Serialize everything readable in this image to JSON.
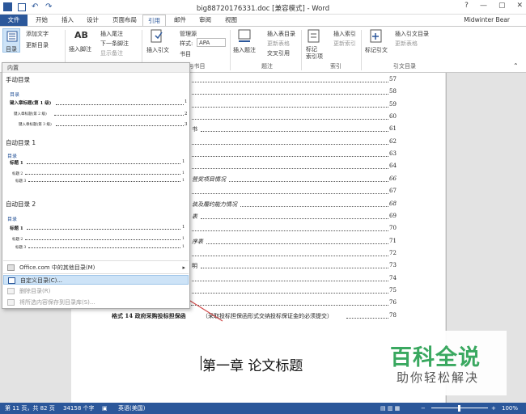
{
  "window": {
    "title": "big88720176331.doc [兼容模式] - Word",
    "user": "Midwinter Bear",
    "controls": [
      "?",
      "—",
      "▢",
      "✕"
    ]
  },
  "tabs": [
    "文件",
    "开始",
    "插入",
    "设计",
    "页面布局",
    "引用",
    "邮件",
    "审阅",
    "视图"
  ],
  "active_tab": "引用",
  "ribbon": {
    "toc": {
      "button": "目录",
      "add_text": "添加文字",
      "update": "更新目录"
    },
    "footnotes": {
      "insert_footnote": "插入脚注",
      "insert_endnote": "插入尾注",
      "next_footnote": "下一条脚注",
      "show_notes": "显示备注",
      "ab": "AB",
      "group": "脚注"
    },
    "citations": {
      "insert_citation": "插入引文",
      "manage_sources": "管理源",
      "style_label": "样式:",
      "style_value": "APA",
      "bibliography": "书目",
      "group": "引文与书目"
    },
    "captions": {
      "insert_caption": "插入题注",
      "insert_table_of_figures": "插入表目录",
      "update_table": "更新表格",
      "cross_reference": "交叉引用",
      "group": "题注"
    },
    "index": {
      "mark_entry": "标记\n索引项",
      "insert_index": "插入索引",
      "update_index": "更新索引",
      "group": "索引"
    },
    "toa": {
      "mark_citation": "标记引文",
      "insert_toa": "插入引文目录",
      "update_toa": "更新表格",
      "group": "引文目录"
    }
  },
  "dropdown": {
    "header": "内置",
    "sections": [
      {
        "title": "手动目录",
        "preview": [
          "目录",
          "键入章标题(第 1 级)",
          "键入章标题(第 2 级)",
          "键入章标题(第 3 级)"
        ],
        "pages": [
          "1",
          "2",
          "3"
        ]
      },
      {
        "title": "自动目录 1",
        "preview": [
          "目录",
          "标题 1",
          "标题 2",
          "标题 3"
        ],
        "pages": [
          "1",
          "1",
          "1"
        ]
      },
      {
        "title": "自动目录 2",
        "preview": [
          "目录",
          "标题 1",
          "标题 2",
          "标题 3"
        ],
        "pages": [
          "1",
          "1",
          "1"
        ]
      }
    ],
    "menu": [
      {
        "label": "Office.com 中的其他目录(M)",
        "arrow": "▸",
        "enabled": true,
        "highlight": false
      },
      {
        "label": "自定义目录(C)...",
        "enabled": true,
        "highlight": true
      },
      {
        "label": "删除目录(R)",
        "enabled": false,
        "highlight": false
      },
      {
        "label": "将所选内容保存到目录库(S)...",
        "enabled": false,
        "highlight": false
      }
    ]
  },
  "toc_entries": [
    {
      "text": "",
      "page": "57"
    },
    {
      "text": "",
      "page": "58"
    },
    {
      "text": "",
      "page": "59"
    },
    {
      "text": "",
      "page": "60"
    },
    {
      "text": "书",
      "page": "61"
    },
    {
      "text": "",
      "page": "62"
    },
    {
      "text": "",
      "page": "63"
    },
    {
      "text": "",
      "page": "64"
    },
    {
      "text": "营奖项目情况",
      "page": "66"
    },
    {
      "text": "",
      "page": "67"
    },
    {
      "text": "装及履约能力情况",
      "page": "68"
    },
    {
      "text": "表",
      "page": "69"
    },
    {
      "text": "",
      "page": "70"
    },
    {
      "text": "序表",
      "page": "71"
    },
    {
      "text": "",
      "page": "72"
    },
    {
      "text": "明",
      "page": "73"
    },
    {
      "text": "",
      "page": "74"
    },
    {
      "text": "",
      "page": "75"
    },
    {
      "text": "格式 13 中小企业声明函",
      "page": "76"
    },
    {
      "text": "格式 14 政府采购投标担保函",
      "extra": "（采取投标担保函形式交纳投标保证金的必须提交）",
      "page": "78"
    }
  ],
  "chapter_heading": "第一章  论文标题",
  "status": {
    "page": "第 11 页，共 82 页",
    "words": "34158 个字",
    "lang": "英语(美国)",
    "zoom": "100%"
  },
  "watermark": {
    "line1": "百科全说",
    "line2": "助你轻松解决"
  },
  "colors": {
    "accent": "#2b579a",
    "highlight": "#cde3f7",
    "watermark": "#3aa860",
    "arrow": "#d04a4a"
  }
}
